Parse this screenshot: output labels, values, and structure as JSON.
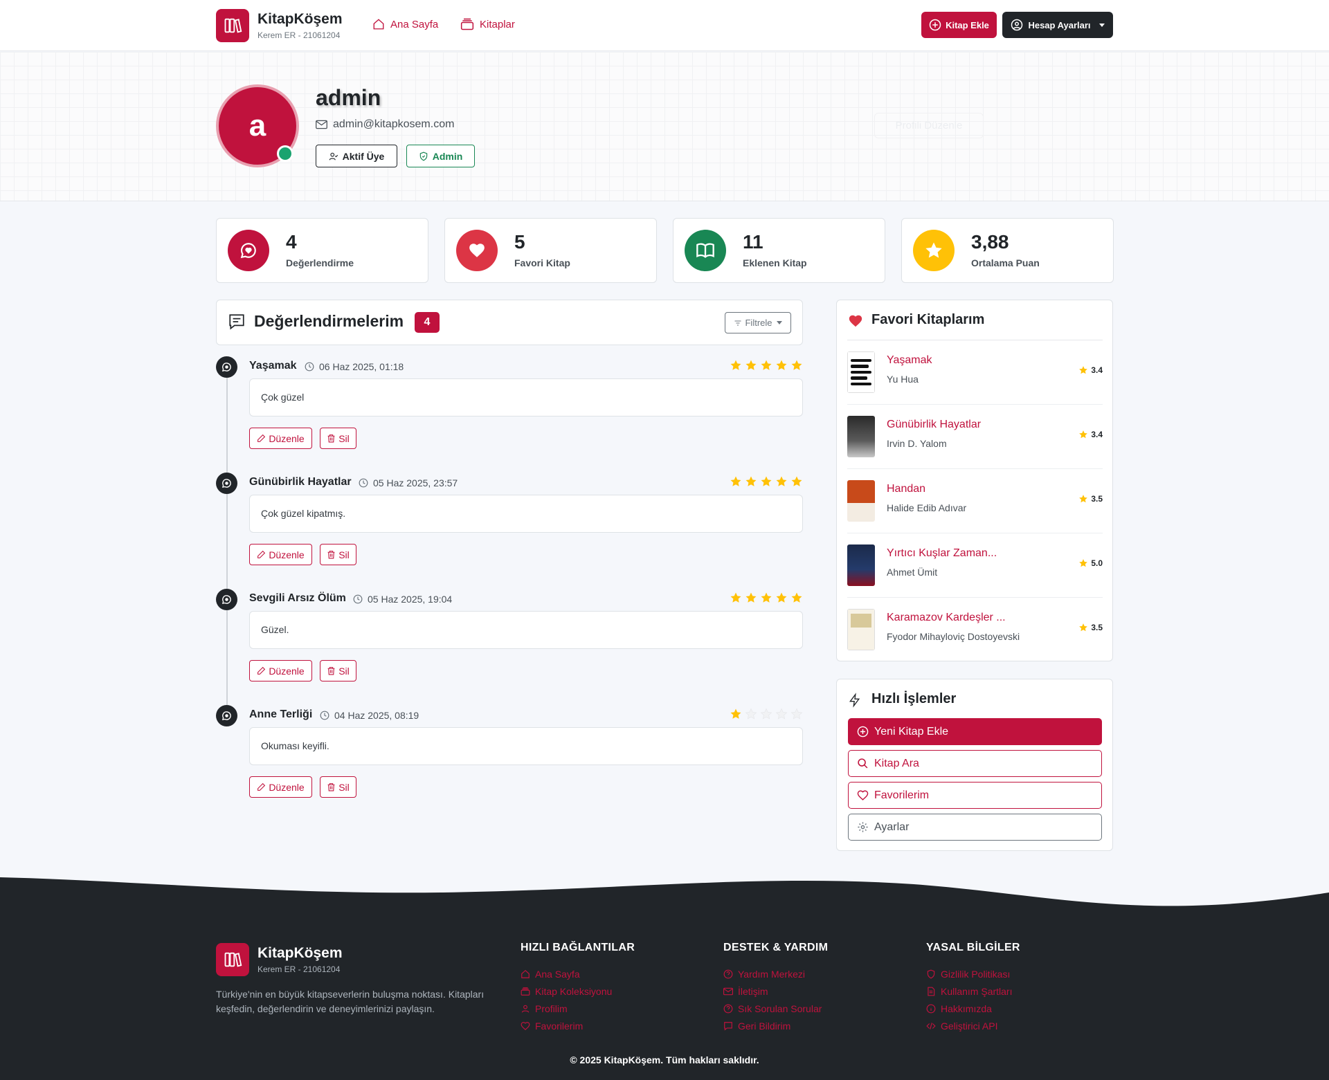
{
  "brand": {
    "title": "KitapKöşem",
    "subtitle": "Kerem ER - 21061204"
  },
  "nav": {
    "home": "Ana Sayfa",
    "books": "Kitaplar",
    "add_book": "Kitap Ekle",
    "account": "Hesap Ayarları"
  },
  "profile": {
    "initial": "a",
    "username": "admin",
    "email": "admin@kitapkosem.com",
    "badge_member": "Aktif Üye",
    "badge_role": "Admin",
    "edit_profile": "Profili Düzenle"
  },
  "stats": [
    {
      "value": "4",
      "label": "Değerlendirme",
      "color": "#c0123d",
      "icon": "chat-heart-icon"
    },
    {
      "value": "5",
      "label": "Favori Kitap",
      "color": "#dc3545",
      "icon": "heart-icon"
    },
    {
      "value": "11",
      "label": "Eklenen Kitap",
      "color": "#198754",
      "icon": "book-icon"
    },
    {
      "value": "3,88",
      "label": "Ortalama Puan",
      "color": "#ffc107",
      "icon": "star-icon"
    }
  ],
  "reviews": {
    "title": "Değerlendirmelerim",
    "count": "4",
    "filter": "Filtrele",
    "edit_label": "Düzenle",
    "delete_label": "Sil",
    "items": [
      {
        "book": "Yaşamak",
        "date": "06 Haz 2025, 01:18",
        "rating": 5,
        "text": "Çok güzel"
      },
      {
        "book": "Günübirlik Hayatlar",
        "date": "05 Haz 2025, 23:57",
        "rating": 5,
        "text": "Çok güzel kipatmış."
      },
      {
        "book": "Sevgili Arsız Ölüm",
        "date": "05 Haz 2025, 19:04",
        "rating": 5,
        "text": "Güzel."
      },
      {
        "book": "Anne Terliği",
        "date": "04 Haz 2025, 08:19",
        "rating": 1,
        "text": "Okuması keyifli."
      }
    ]
  },
  "favorites": {
    "title": "Favori Kitaplarım",
    "items": [
      {
        "title": "Yaşamak",
        "author": "Yu Hua",
        "rating": "3.4"
      },
      {
        "title": "Günübirlik Hayatlar",
        "author": "Irvin D. Yalom",
        "rating": "3.4"
      },
      {
        "title": "Handan",
        "author": "Halide Edib Adıvar",
        "rating": "3.5"
      },
      {
        "title": "Yırtıcı Kuşlar Zaman...",
        "author": "Ahmet Ümit",
        "rating": "5.0"
      },
      {
        "title": "Karamazov Kardeşler ...",
        "author": "Fyodor Mihayloviç Dostoyevski",
        "rating": "3.5"
      }
    ]
  },
  "quick": {
    "title": "Hızlı İşlemler",
    "buttons": [
      {
        "label": "Yeni Kitap Ekle",
        "icon": "plus-circle-icon"
      },
      {
        "label": "Kitap Ara",
        "icon": "search-icon"
      },
      {
        "label": "Favorilerim",
        "icon": "heart-icon"
      },
      {
        "label": "Ayarlar",
        "icon": "gear-icon"
      }
    ]
  },
  "footer": {
    "description": "Türkiye'nin en büyük kitapseverlerin buluşma noktası. Kitapları keşfedin, değerlendirin ve deneyimlerinizi paylaşın.",
    "col1": {
      "title": "HIZLI BAĞLANTILAR",
      "links": [
        "Ana Sayfa",
        "Kitap Koleksiyonu",
        "Profilim",
        "Favorilerim"
      ]
    },
    "col2": {
      "title": "DESTEK & YARDIM",
      "links": [
        "Yardım Merkezi",
        "İletişim",
        "Sık Sorulan Sorular",
        "Geri Bildirim"
      ]
    },
    "col3": {
      "title": "YASAL BİLGİLER",
      "links": [
        "Gizlilik Politikası",
        "Kullanım Şartları",
        "Hakkımızda",
        "Geliştirici API"
      ]
    },
    "copyright": "© 2025 KitapKöşem. Tüm hakları saklıdır."
  },
  "colors": {
    "accent": "#c0123d",
    "dark": "#212529",
    "success": "#198754",
    "warning": "#ffc107"
  }
}
